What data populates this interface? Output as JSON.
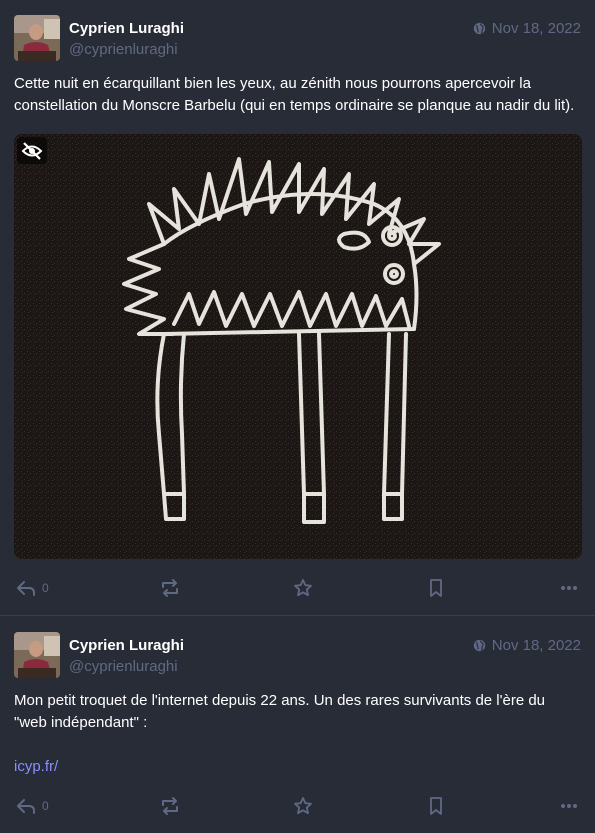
{
  "statuses": [
    {
      "display_name": "Cyprien Luraghi",
      "acct": "@cyprienluraghi",
      "date": "Nov 18, 2022",
      "content": "Cette nuit en écarquillant bien les yeux, au zénith nous pourrons apercevoir la constellation du Monscre Barbelu (qui en temps ordinaire se planque au nadir du lit).",
      "media": {
        "description_icon": "eye-slash-icon"
      },
      "reply_count": "0"
    },
    {
      "display_name": "Cyprien Luraghi",
      "acct": "@cyprienluraghi",
      "date": "Nov 18, 2022",
      "content_line1": "Mon petit troquet de l'internet depuis 22 ans. Un des rares survivants de l'ère du \"web indépendant\" :",
      "link": "icyp.fr/",
      "reply_count": "0"
    }
  ],
  "colors": {
    "background": "#282c37",
    "muted": "#606984",
    "link": "#8c8dff",
    "divider": "#393f4f"
  }
}
